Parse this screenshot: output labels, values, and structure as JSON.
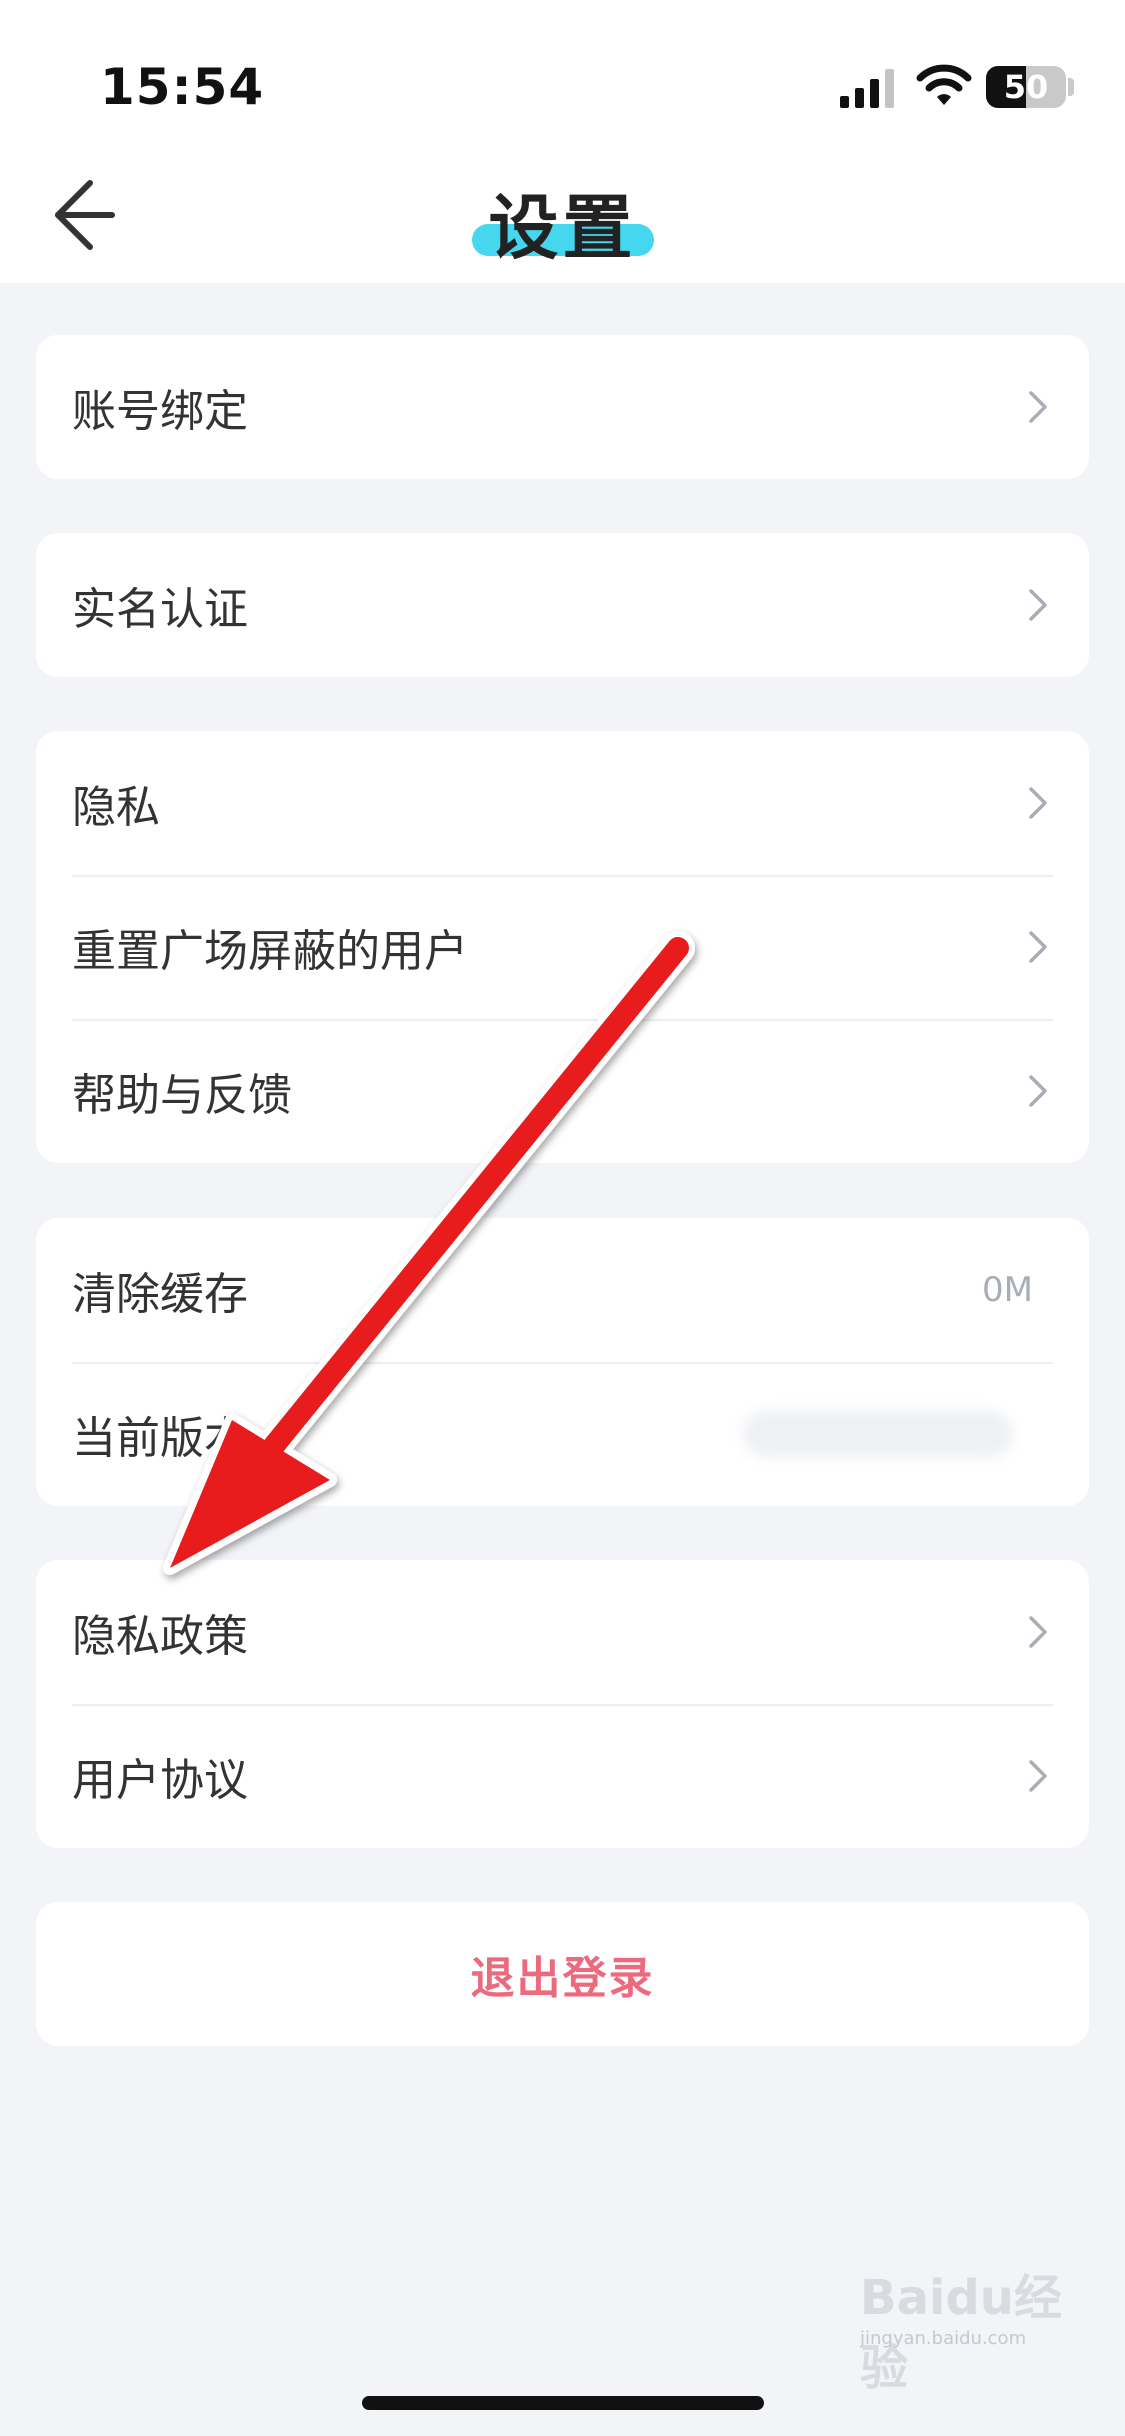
{
  "status_bar": {
    "time": "15:54",
    "battery": "50",
    "battery_level": 0.5
  },
  "header": {
    "title": "设置"
  },
  "sections": [
    {
      "items": [
        {
          "label": "账号绑定"
        }
      ]
    },
    {
      "items": [
        {
          "label": "实名认证"
        }
      ]
    },
    {
      "items": [
        {
          "label": "隐私"
        },
        {
          "label": "重置广场屏蔽的用户"
        },
        {
          "label": "帮助与反馈"
        }
      ]
    },
    {
      "items": [
        {
          "label": "清除缓存",
          "value": "0M"
        },
        {
          "label": "当前版本"
        }
      ]
    },
    {
      "items": [
        {
          "label": "隐私政策"
        },
        {
          "label": "用户协议"
        }
      ]
    }
  ],
  "logout": {
    "label": "退出登录"
  },
  "annotation": {
    "arrow_color": "#e81c1c",
    "points_to": "隐私政策"
  },
  "watermark": {
    "text": "Baidu经验",
    "sub": "jingyan.baidu.com"
  },
  "colors": {
    "accent": "#45d7ee",
    "logout": "#ec6a7d",
    "background": "#f3f4f8"
  }
}
